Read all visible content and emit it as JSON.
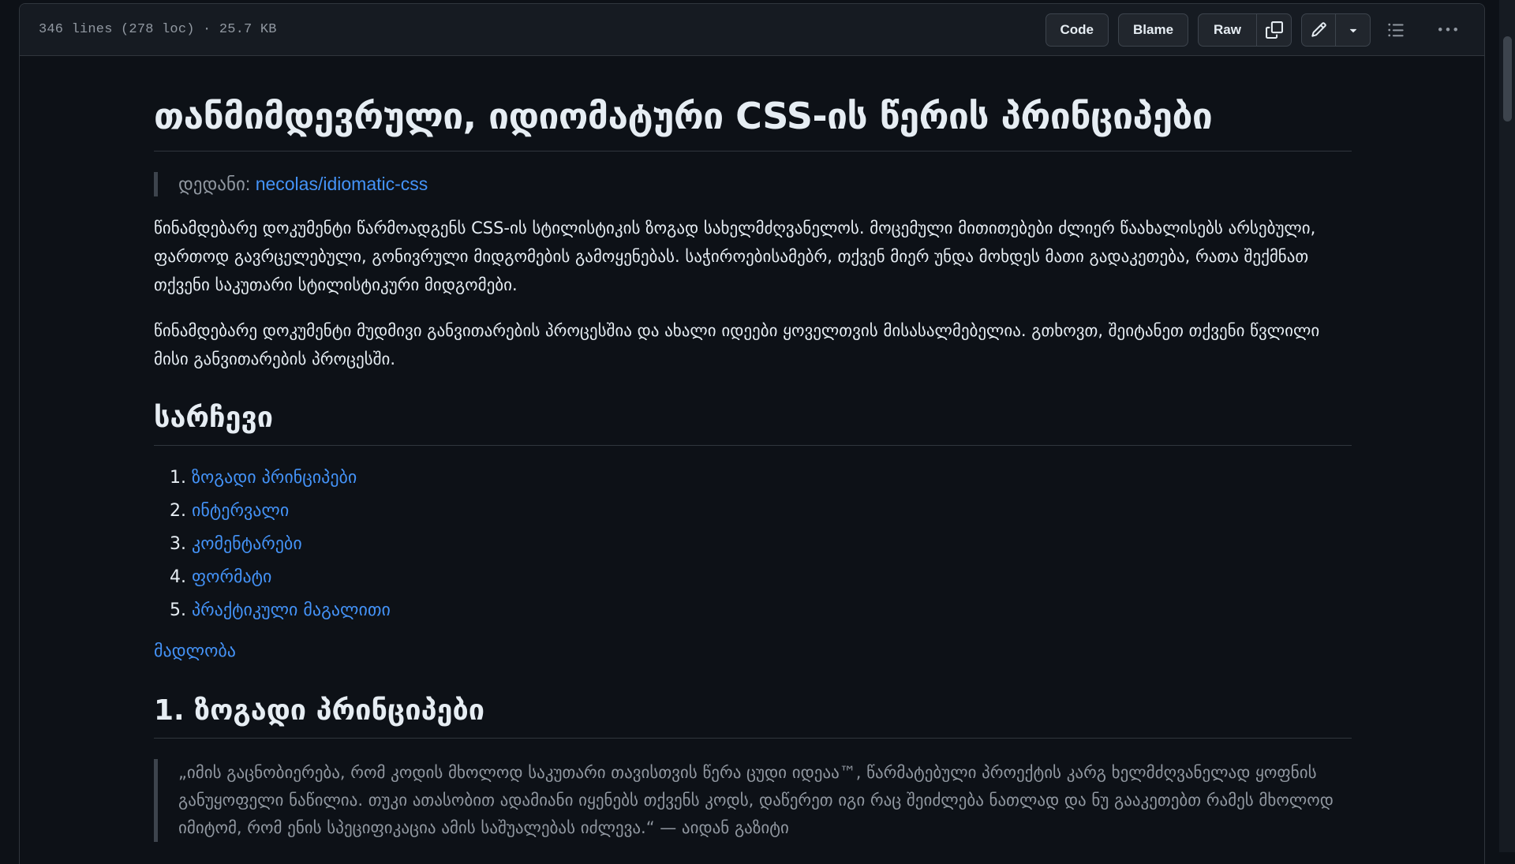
{
  "file_header": {
    "meta": "346 lines (278 loc) · 25.7 KB",
    "code_label": "Code",
    "blame_label": "Blame",
    "raw_label": "Raw"
  },
  "icons": {
    "copy": "copy-icon",
    "edit": "pencil-icon",
    "dropdown": "triangle-down-icon",
    "outline": "list-unordered-icon",
    "more": "kebab-horizontal-icon"
  },
  "document": {
    "title": "თანმიმდევრული, იდიომატური CSS-ის წერის პრინციპები",
    "source_prefix": "დედანი: ",
    "source_link": "necolas/idiomatic-css",
    "intro_paragraph_1": "წინამდებარე დოკუმენტი წარმოადგენს CSS-ის სტილისტიკის ზოგად სახელმძღვანელოს. მოცემული მითითებები ძლიერ წაახალისებს არსებული, ფართოდ გავრცელებული, გონივრული მიდგომების გამოყენებას. საჭიროებისამებრ, თქვენ მიერ უნდა მოხდეს მათი გადაკეთება, რათა შექმნათ თქვენი საკუთარი სტილისტიკური მიდგომები.",
    "intro_paragraph_2": "წინამდებარე დოკუმენტი მუდმივი განვითარების პროცესშია და ახალი იდეები ყოველთვის მისასალმებელია. გთხოვთ, შეიტანეთ თქვენი წვლილი მისი განვითარების პროცესში.",
    "toc_heading": "სარჩევი",
    "toc": [
      {
        "num": "1.",
        "label": "ზოგადი პრინციპები"
      },
      {
        "num": "2.",
        "label": "ინტერვალი"
      },
      {
        "num": "3.",
        "label": "კომენტარები"
      },
      {
        "num": "4.",
        "label": "ფორმატი"
      },
      {
        "num": "5.",
        "label": "პრაქტიკული მაგალითი"
      }
    ],
    "thanks_link": "მადლობა",
    "section1_heading": "1. ზოგადი პრინციპები",
    "section1_quote": "„იმის გაცნობიერება, რომ კოდის მხოლოდ საკუთარი თავისთვის წერა ცუდი იდეაა™, წარმატებული პროექტის კარგ ხელმძღვანელად ყოფნის განუყოფელი ნაწილია. თუკი ათასობით ადამიანი იყენებს თქვენს კოდს, დაწერეთ იგი რაც შეიძლება ნათლად და ნუ გააკეთებთ რამეს მხოლოდ იმიტომ, რომ ენის სპეციფიკაცია ამის საშუალებას იძლევა.“ — აიდან გაზიტი"
  },
  "colors": {
    "background": "#0d1117",
    "header": "#161b22",
    "border": "#30363d",
    "link": "#4493f8",
    "muted": "#9198a1"
  }
}
